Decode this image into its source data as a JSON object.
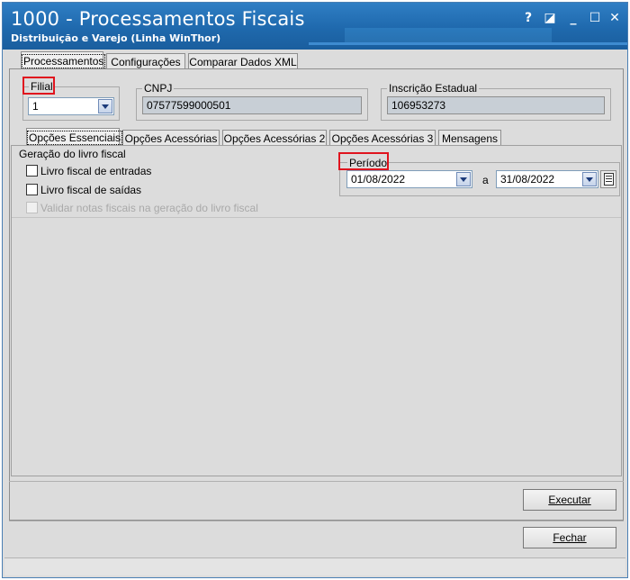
{
  "window": {
    "title": "1000 - Processamentos Fiscais",
    "subtitle": "Distribuição e Varejo (Linha WinThor)",
    "controls": {
      "help": "?",
      "restore": "◪",
      "minimize": "_",
      "maximize": "☐",
      "close": "✕"
    }
  },
  "main_tabs": [
    {
      "label": "Processamentos",
      "active": true
    },
    {
      "label": "Configurações",
      "active": false
    },
    {
      "label": "Comparar Dados XML",
      "active": false
    }
  ],
  "filial": {
    "legend": "Filial",
    "value": "1"
  },
  "cnpj": {
    "legend": "CNPJ",
    "value": "07577599000501"
  },
  "inscricao": {
    "legend": "Inscrição Estadual",
    "value": "106953273"
  },
  "sub_tabs": [
    {
      "label": "Opções Essenciais",
      "active": true
    },
    {
      "label": "Opções Acessórias",
      "active": false
    },
    {
      "label": "Opções Acessórias 2",
      "active": false
    },
    {
      "label": "Opções Acessórias 3",
      "active": false
    },
    {
      "label": "Mensagens",
      "active": false
    }
  ],
  "geracao": {
    "title": "Geração do livro fiscal",
    "options": [
      {
        "label": "Livro fiscal de entradas",
        "checked": false,
        "enabled": true
      },
      {
        "label": "Livro fiscal de saídas",
        "checked": false,
        "enabled": true
      },
      {
        "label": "Validar notas fiscais na geração do livro fiscal",
        "checked": false,
        "enabled": false
      }
    ]
  },
  "periodo": {
    "legend": "Período",
    "start": "01/08/2022",
    "separator": "a",
    "end": "31/08/2022"
  },
  "buttons": {
    "executar": "Executar",
    "fechar": "Fechar"
  },
  "colors": {
    "title_bar": "#1f69ad",
    "highlight_box": "#e0141e"
  }
}
